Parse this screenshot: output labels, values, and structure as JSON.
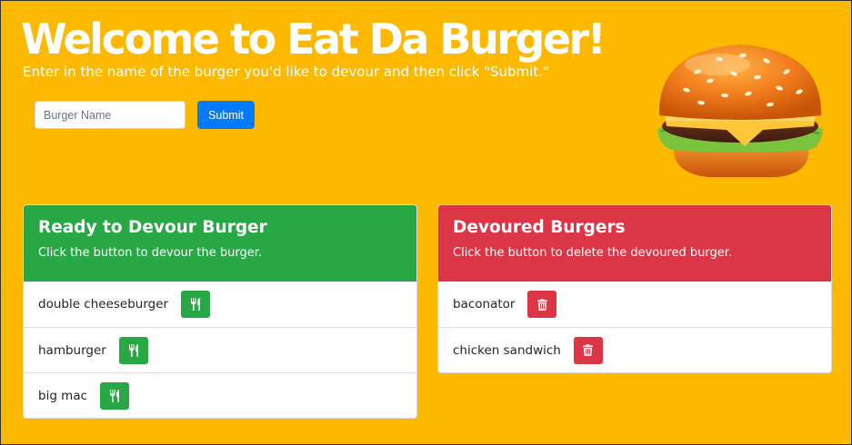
{
  "header": {
    "title": "Welcome to Eat Da Burger!",
    "subtitle": "Enter in the name of the burger you'd like to devour and then click \"Submit.\""
  },
  "form": {
    "input_placeholder": "Burger Name",
    "input_value": "",
    "submit_label": "Submit"
  },
  "ready_card": {
    "title": "Ready to Devour Burger",
    "subtitle": "Click the button to devour the burger.",
    "action_icon": "utensils-icon",
    "items": [
      {
        "name": "double cheeseburger"
      },
      {
        "name": "hamburger"
      },
      {
        "name": "big mac"
      }
    ]
  },
  "devoured_card": {
    "title": "Devoured Burgers",
    "subtitle": "Click the button to delete the devoured burger.",
    "action_icon": "trash-icon",
    "items": [
      {
        "name": "baconator"
      },
      {
        "name": "chicken sandwich"
      }
    ]
  },
  "colors": {
    "background": "#FCB900",
    "ready": "#28a745",
    "devoured": "#dc3545",
    "submit": "#007bff"
  }
}
